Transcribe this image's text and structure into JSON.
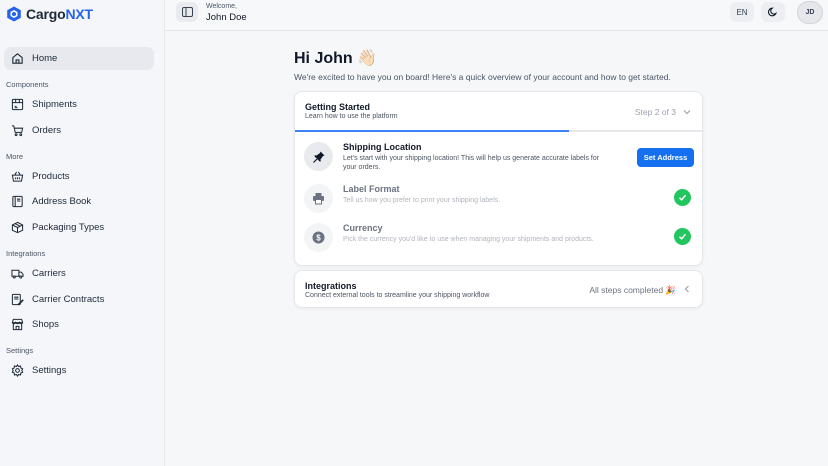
{
  "brand": {
    "name_part1": "Cargo",
    "name_part2": "NXT"
  },
  "header": {
    "welcome": "Welcome,",
    "user_name": "John Doe",
    "lang": "EN",
    "avatar_initials": "JD"
  },
  "sidebar": {
    "home": "Home",
    "sections": {
      "components": "Components",
      "more": "More",
      "integrations": "Integrations",
      "settings": "Settings"
    },
    "items": {
      "shipments": "Shipments",
      "orders": "Orders",
      "products": "Products",
      "address_book": "Address Book",
      "packaging_types": "Packaging Types",
      "carriers": "Carriers",
      "carrier_contracts": "Carrier Contracts",
      "shops": "Shops",
      "settings": "Settings"
    }
  },
  "main": {
    "greeting": "Hi John 👋🏻",
    "subtitle": "We're excited to have you on board! Here's a quick overview of your account and how to get started.",
    "getting_started": {
      "title": "Getting Started",
      "subtitle": "Learn how to use the platform",
      "step_count": "Step 2 of 3",
      "progress": 0.67,
      "steps": [
        {
          "title": "Shipping Location",
          "description": "Let's start with your shipping location! This will help us generate accurate labels for your orders.",
          "action": "Set Address",
          "icon": "pushpin-icon"
        },
        {
          "title": "Label Format",
          "description": "Tell us how you prefer to print your shipping labels.",
          "icon": "printer-icon",
          "completed": true
        },
        {
          "title": "Currency",
          "description": "Pick the currency you'd like to use when managing your shipments and products.",
          "icon": "dollar-icon",
          "completed": true
        }
      ]
    },
    "integrations": {
      "title": "Integrations",
      "subtitle": "Connect external tools to streamline your shipping workflow",
      "status": "All steps completed 🎉"
    }
  },
  "colors": {
    "accent": "#1570ef",
    "progress": "#3b82f6",
    "success": "#22c55e"
  }
}
